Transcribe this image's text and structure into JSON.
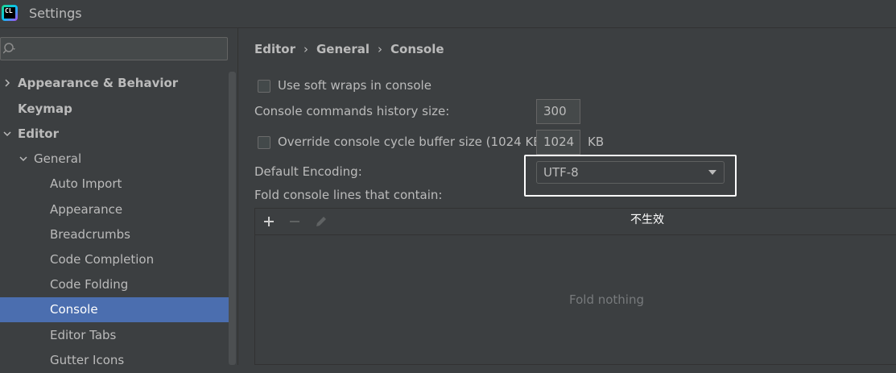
{
  "window": {
    "title": "Settings",
    "app_icon_text": "CL"
  },
  "sidebar": {
    "search": {
      "placeholder": ""
    },
    "items": [
      {
        "label": "Appearance & Behavior"
      },
      {
        "label": "Keymap"
      },
      {
        "label": "Editor"
      },
      {
        "label": "General"
      },
      {
        "label": "Auto Import"
      },
      {
        "label": "Appearance"
      },
      {
        "label": "Breadcrumbs"
      },
      {
        "label": "Code Completion"
      },
      {
        "label": "Code Folding"
      },
      {
        "label": "Console",
        "selected": true
      },
      {
        "label": "Editor Tabs"
      },
      {
        "label": "Gutter Icons"
      }
    ]
  },
  "breadcrumb": {
    "items": [
      "Editor",
      "General",
      "Console"
    ],
    "separator": "›"
  },
  "settings": {
    "soft_wraps": {
      "label": "Use soft wraps in console",
      "checked": false
    },
    "history_size": {
      "label": "Console commands history size:",
      "value": "300"
    },
    "cycle_buffer": {
      "label": "Override console cycle buffer size (1024 KB)",
      "checked": false,
      "value": "1024",
      "unit": "KB"
    },
    "encoding": {
      "label": "Default Encoding:",
      "value": "UTF-8"
    },
    "fold_lines": {
      "label": "Fold console lines that contain:",
      "empty_text": "Fold nothing"
    }
  },
  "annotation": {
    "text": "不生效"
  },
  "colors": {
    "selection": "#4b6eaf",
    "background": "#3c3f41",
    "highlight_box": "#ffffff"
  }
}
